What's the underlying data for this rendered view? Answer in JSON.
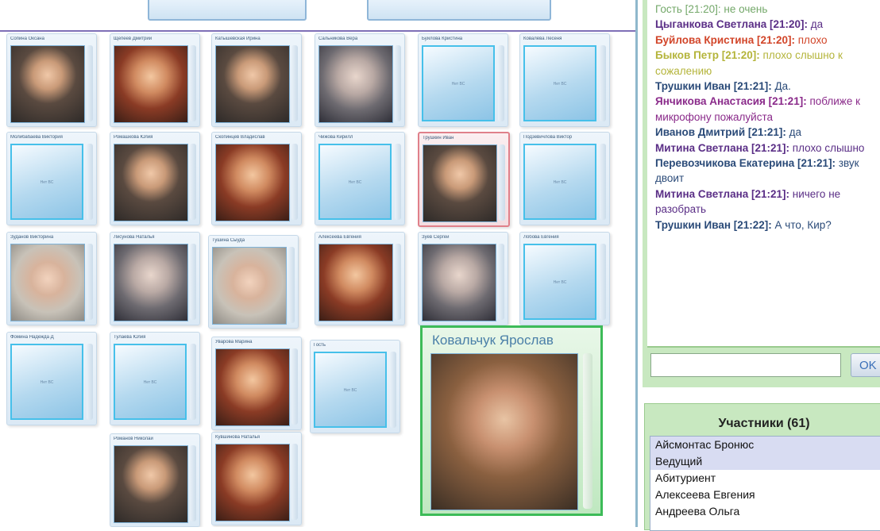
{
  "video_grid": {
    "tiles": [
      {
        "name": "Сопина Оксана",
        "video": true,
        "style": "cam"
      },
      {
        "name": "Щепеев Дмитрий",
        "video": true,
        "style": "warm"
      },
      {
        "name": "Катышевская Ирина",
        "video": true,
        "style": "cam"
      },
      {
        "name": "Сальникова Вера",
        "video": true,
        "style": "cool"
      },
      {
        "name": "Буйлова Кристина",
        "video": false
      },
      {
        "name": "Ковалёва Лесеня",
        "video": false
      },
      {
        "name": "Молибабаева Виктория",
        "video": false
      },
      {
        "name": "Ромашкова Юлия",
        "video": true,
        "style": "cam"
      },
      {
        "name": "Скопинцев Владислав",
        "video": true,
        "style": "warm"
      },
      {
        "name": "Чижова Кирилл",
        "video": false
      },
      {
        "name": "Трушкин Иван",
        "video": true,
        "style": "cam",
        "selected": true
      },
      {
        "name": "Подзевичлова Виктор",
        "video": false
      },
      {
        "name": "Зуданов Викторина",
        "video": true,
        "style": "light"
      },
      {
        "name": "Лисунова Наталья",
        "video": true,
        "style": "cool"
      },
      {
        "name": "Тушина Сыуда",
        "video": true,
        "style": "light"
      },
      {
        "name": "Алексеева Евгения",
        "video": true,
        "style": "warm"
      },
      {
        "name": "Зуев Сергей",
        "video": true,
        "style": "cool"
      },
      {
        "name": "Лобова Евгения",
        "video": false
      },
      {
        "name": "Фомина Надежда Д",
        "video": false
      },
      {
        "name": "Тулаева Юлия",
        "video": false
      },
      {
        "name": "Уварова Марина",
        "video": true,
        "style": "warm"
      },
      {
        "name": "Гость",
        "video": false
      },
      {
        "name": "Романов Николай",
        "video": true,
        "style": "cam"
      },
      {
        "name": "Кувшинова Наталья",
        "video": true,
        "style": "warm"
      }
    ],
    "no_video_label": "Нет ВС",
    "big": {
      "name": "Ковальчук Ярослав"
    }
  },
  "chat": {
    "lines": [
      {
        "name": "Гость [21:20]:",
        "msg": " не очень",
        "color": "#74a86a",
        "bold": false
      },
      {
        "name": "Цыганкова Светлана [21:20]:",
        "msg": " да",
        "color": "#5a2e86",
        "bold": true,
        "msg_color": "#5a2e86"
      },
      {
        "name": "Буйлова Кристина [21:20]:",
        "msg": " плохо",
        "color": "#d2462a",
        "bold": true,
        "msg_color": "#d2462a"
      },
      {
        "name": "Быков Петр [21:20]:",
        "msg": " плохо слышно к сожалению",
        "color": "#b4b43a",
        "bold": true,
        "msg_color": "#b4b43a"
      },
      {
        "name": "Трушкин Иван [21:21]:",
        "msg": " Да.",
        "color": "#2a4a78",
        "bold": true,
        "msg_color": "#2a4a78"
      },
      {
        "name": "Янчикова Анастасия [21:21]:",
        "msg": " поближе к микрофону пожалуйста",
        "color": "#8a2a8a",
        "bold": true,
        "msg_color": "#8a2a8a"
      },
      {
        "name": "Иванов Дмитрий [21:21]:",
        "msg": " да",
        "color": "#2a4a78",
        "bold": true,
        "msg_color": "#2a4a78"
      },
      {
        "name": "Митина Светлана [21:21]:",
        "msg": " плохо слышно",
        "color": "#5a2e86",
        "bold": true,
        "msg_color": "#5a2e86"
      },
      {
        "name": "Перевозчикова Екатерина [21:21]:",
        "msg": " звук двоит",
        "color": "#2a4a78",
        "bold": true,
        "msg_color": "#2a4a78"
      },
      {
        "name": "Митина Светлана [21:21]:",
        "msg": " ничего не разобрать",
        "color": "#5a2e86",
        "bold": true,
        "msg_color": "#5a2e86"
      },
      {
        "name": "Трушкин Иван [21:22]:",
        "msg": " А что, Кир?",
        "color": "#2a4a78",
        "bold": true,
        "msg_color": "#2a4a78"
      }
    ],
    "input_value": "",
    "ok_label": "OK"
  },
  "participants": {
    "title": "Участники (61)",
    "items": [
      {
        "label": "Айсмонтас Бронюс",
        "selected": true
      },
      {
        "label": "Ведущий",
        "selected": true
      },
      {
        "label": "Абитуриент",
        "selected": false
      },
      {
        "label": "Алексеева Евгения",
        "selected": false
      },
      {
        "label": "Андреева Ольга",
        "selected": false
      }
    ]
  }
}
